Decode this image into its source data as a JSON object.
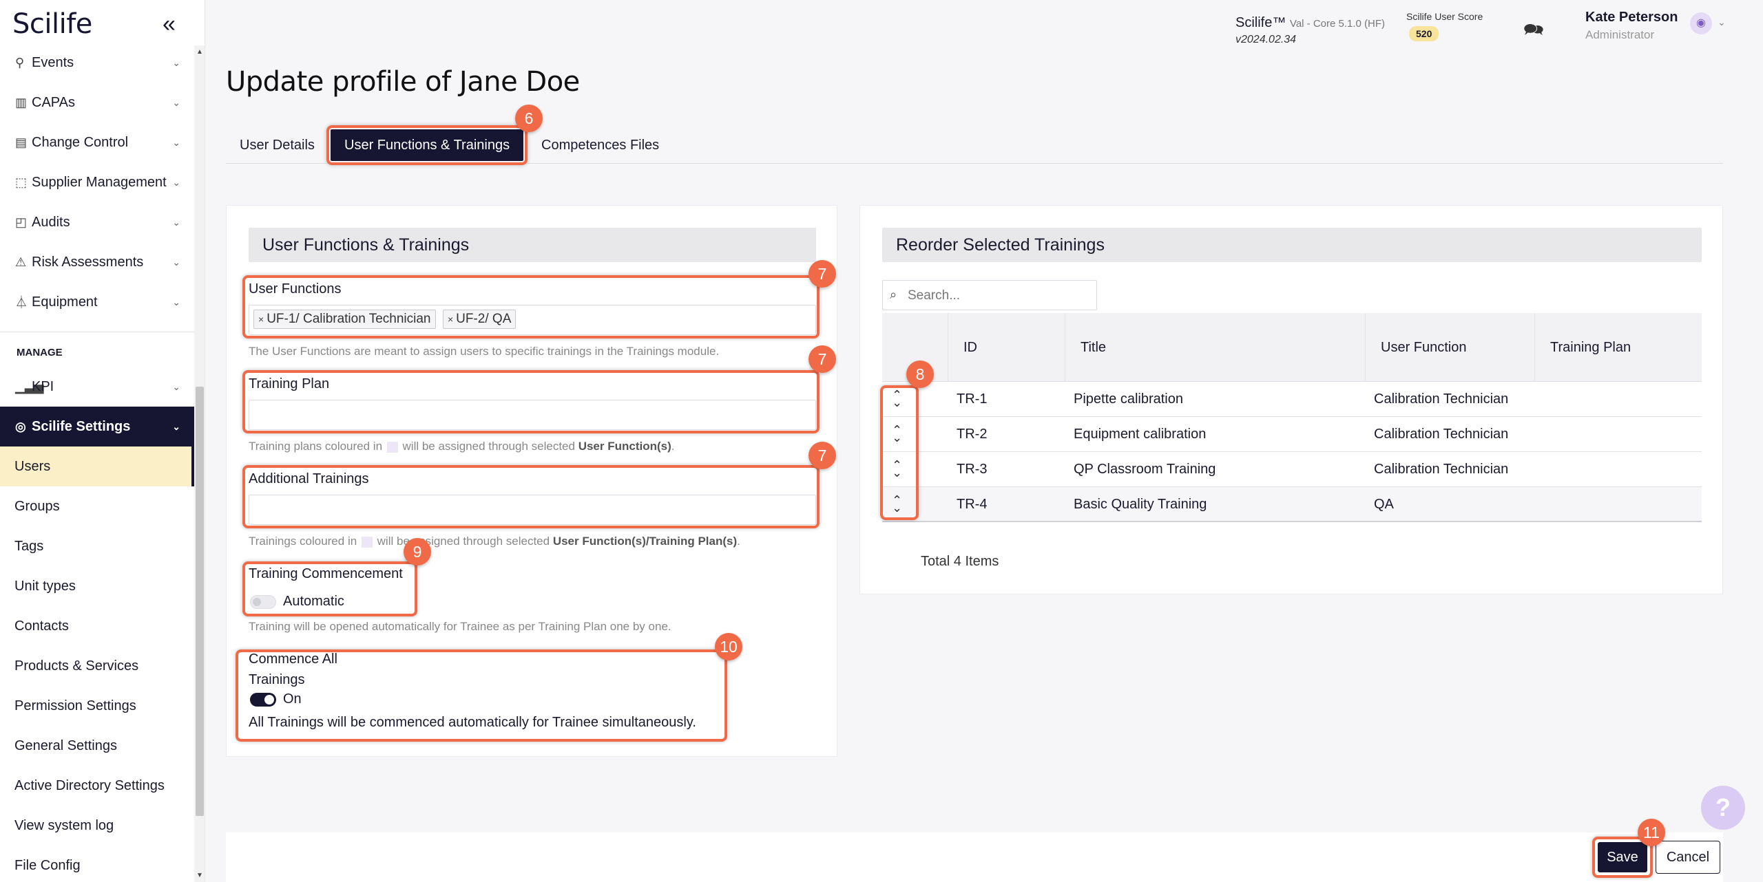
{
  "app": {
    "brand": "Scilife",
    "collapse_glyph": "«"
  },
  "header": {
    "product": "Scilife™",
    "product_suffix": "Val - Core 5.1.0 (HF)",
    "version": "v2024.02.34",
    "score_label": "Scilife User Score",
    "score_value": "520",
    "user_name": "Kate Peterson",
    "user_role": "Administrator"
  },
  "sidebar": {
    "items": [
      {
        "label": "Events",
        "icon": "pin-icon"
      },
      {
        "label": "CAPAs",
        "icon": "chart-icon"
      },
      {
        "label": "Change Control",
        "icon": "document-icon"
      },
      {
        "label": "Supplier Management",
        "icon": "box-icon"
      },
      {
        "label": "Audits",
        "icon": "clipboard-icon"
      },
      {
        "label": "Risk Assessments",
        "icon": "warning-icon"
      },
      {
        "label": "Equipment",
        "icon": "flask-icon"
      }
    ],
    "section_manage": "MANAGE",
    "kpi": "KPI",
    "settings": "Scilife Settings",
    "sub_items": [
      "Users",
      "Groups",
      "Tags",
      "Unit types",
      "Contacts",
      "Products & Services",
      "Permission Settings",
      "General Settings",
      "Active Directory Settings",
      "View system log",
      "File Config"
    ]
  },
  "page": {
    "title": "Update profile of Jane Doe",
    "tabs": [
      "User Details",
      "User Functions & Trainings",
      "Competences Files"
    ]
  },
  "left_card": {
    "heading": "User Functions & Trainings",
    "user_functions_label": "User Functions",
    "chips": [
      "UF-1/ Calibration Technician",
      "UF-2/ QA"
    ],
    "chip_remove": "×",
    "user_functions_hint": "The User Functions are meant to assign users to specific trainings in the Trainings module.",
    "training_plan_label": "Training Plan",
    "training_plan_hint_a": "Training plans coloured in",
    "training_plan_hint_b": "will be assigned through selected",
    "training_plan_hint_bold": "User Function(s)",
    "training_plan_hint_end": ".",
    "additional_label": "Additional Trainings",
    "additional_hint_a": "Trainings coloured in",
    "additional_hint_b": "will be assigned through selected",
    "additional_hint_bold": "User Function(s)/Training Plan(s)",
    "additional_hint_end": ".",
    "commencement_label": "Training Commencement",
    "commencement_toggle_text": "Automatic",
    "commencement_toggle_on": false,
    "commencement_hint": "Training will be opened automatically for Trainee as per Training Plan one by one.",
    "commence_all_line1": "Commence All",
    "commence_all_line2": "Trainings",
    "commence_all_toggle_text": "On",
    "commence_all_toggle_on": true,
    "commence_all_hint": "All Trainings will be commenced automatically for Trainee simultaneously."
  },
  "right_card": {
    "heading": "Reorder Selected Trainings",
    "search_placeholder": "Search...",
    "columns": [
      "ID",
      "Title",
      "User Function",
      "Training Plan"
    ],
    "rows": [
      {
        "id": "TR-1",
        "title": "Pipette calibration",
        "function": "Calibration Technician",
        "plan": ""
      },
      {
        "id": "TR-2",
        "title": "Equipment calibration",
        "function": "Calibration Technician",
        "plan": ""
      },
      {
        "id": "TR-3",
        "title": "QP Classroom Training",
        "function": "Calibration Technician",
        "plan": ""
      },
      {
        "id": "TR-4",
        "title": "Basic Quality Training",
        "function": "QA",
        "plan": ""
      }
    ],
    "total": "Total 4 Items"
  },
  "badges": {
    "tabs": "6",
    "user_functions": "7",
    "training_plan": "7",
    "additional": "7",
    "reorder": "8",
    "commencement": "9",
    "commence_all": "10",
    "save": "11"
  },
  "footer": {
    "save": "Save",
    "cancel": "Cancel"
  },
  "help_glyph": "?",
  "colors": {
    "primary": "#161633",
    "highlight": "#f06a48",
    "selected_bg": "#fbefc7",
    "score_badge": "#f7e39a"
  }
}
